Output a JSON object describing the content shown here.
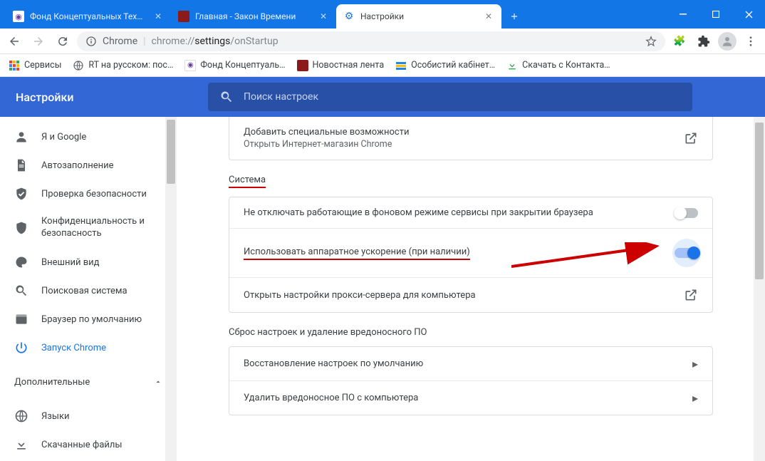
{
  "window_tabs": [
    {
      "title": "Фонд Концептуальных Техноло",
      "favicon_bg": "#fff",
      "glyph": "⦿",
      "glyph_color": "#6b3fa0"
    },
    {
      "title": "Главная - Закон Времени",
      "favicon_bg": "#8b1a1a",
      "glyph": "",
      "glyph_color": "#fff"
    },
    {
      "title": "Настройки",
      "favicon_bg": "transparent",
      "glyph": "⚙",
      "glyph_color": "#1a73e8",
      "active": true
    }
  ],
  "omnibox": {
    "scheme_label": "Chrome",
    "path_prefix": "chrome://",
    "path_bold": "settings",
    "path_suffix": "/onStartup"
  },
  "bookmarks": [
    {
      "label": "Сервисы",
      "ico": "grid",
      "color": "#f29900"
    },
    {
      "label": "RT на русском: пос…",
      "ico": "globe",
      "color": "#5f6368"
    },
    {
      "label": "Фонд Концептуаль…",
      "ico": "dot",
      "color": "#6b3fa0"
    },
    {
      "label": "Новостная лента",
      "ico": "square",
      "color": "#8b1a1a"
    },
    {
      "label": "Особистий кабінет…",
      "ico": "bars",
      "color": "#1e88e5"
    },
    {
      "label": "Скачать с Контакта…",
      "ico": "down",
      "color": "#34a853"
    }
  ],
  "settings": {
    "title": "Настройки",
    "search_placeholder": "Поиск настроек",
    "nav": [
      {
        "id": "you-google",
        "label": "Я и Google",
        "icon": "person"
      },
      {
        "id": "autofill",
        "label": "Автозаполнение",
        "icon": "file"
      },
      {
        "id": "safety",
        "label": "Проверка безопасности",
        "icon": "shield-check"
      },
      {
        "id": "privacy",
        "label": "Конфиденциальность и безопасность",
        "icon": "shield"
      },
      {
        "id": "appearance",
        "label": "Внешний вид",
        "icon": "palette"
      },
      {
        "id": "search",
        "label": "Поисковая система",
        "icon": "search"
      },
      {
        "id": "default",
        "label": "Браузер по умолчанию",
        "icon": "browser"
      },
      {
        "id": "startup",
        "label": "Запуск Chrome",
        "icon": "power",
        "selected": true
      }
    ],
    "advanced_label": "Дополнительные",
    "advanced_items": [
      {
        "id": "lang",
        "label": "Языки",
        "icon": "globe2"
      },
      {
        "id": "downloads",
        "label": "Скачанные файлы",
        "icon": "download"
      }
    ],
    "a11y": {
      "title": "Добавить специальные возможности",
      "sub": "Открыть Интернет-магазин Chrome"
    },
    "system_title": "Система",
    "system_rows": [
      {
        "label": "Не отключать работающие в фоновом режиме сервисы при закрытии браузера",
        "type": "toggle",
        "on": false
      },
      {
        "label": "Использовать аппаратное ускорение (при наличии)",
        "type": "toggle",
        "on": true,
        "underline": true,
        "halo": true
      },
      {
        "label": "Открыть настройки прокси-сервера для компьютера",
        "type": "external"
      }
    ],
    "reset_title": "Сброс настроек и удаление вредоносного ПО",
    "reset_rows": [
      {
        "label": "Восстановление настроек по умолчанию"
      },
      {
        "label": "Удалить вредоносное ПО с компьютера"
      }
    ]
  }
}
